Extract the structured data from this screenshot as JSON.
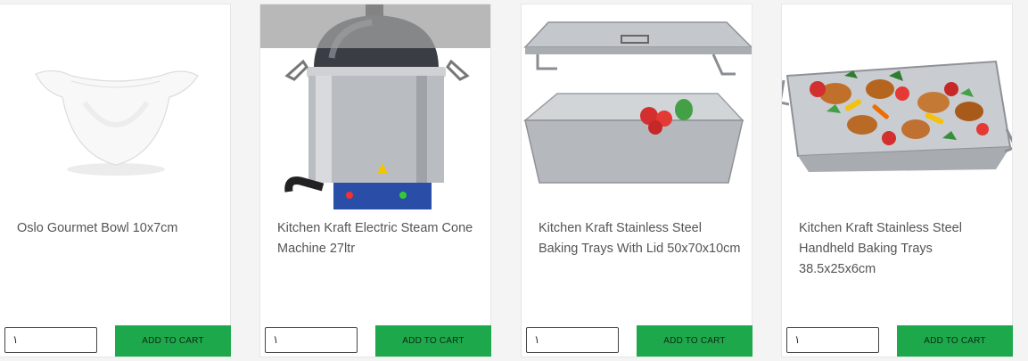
{
  "products": [
    {
      "title": "Oslo Gourmet Bowl 10x7cm",
      "quantity": "١",
      "add_to_cart_label": "ADD TO CART"
    },
    {
      "title": "Kitchen Kraft Electric Steam Cone Machine 27ltr",
      "quantity": "١",
      "add_to_cart_label": "ADD TO CART"
    },
    {
      "title": "Kitchen Kraft Stainless Steel Baking Trays With Lid 50x70x10cm",
      "quantity": "١",
      "add_to_cart_label": "ADD TO CART"
    },
    {
      "title": "Kitchen Kraft Stainless Steel Handheld Baking Trays 38.5x25x6cm",
      "quantity": "١",
      "add_to_cart_label": "ADD TO CART"
    }
  ],
  "colors": {
    "button": "#1ea84c",
    "card_bg": "#ffffff",
    "page_bg": "#f4f4f4",
    "text": "#555555"
  }
}
